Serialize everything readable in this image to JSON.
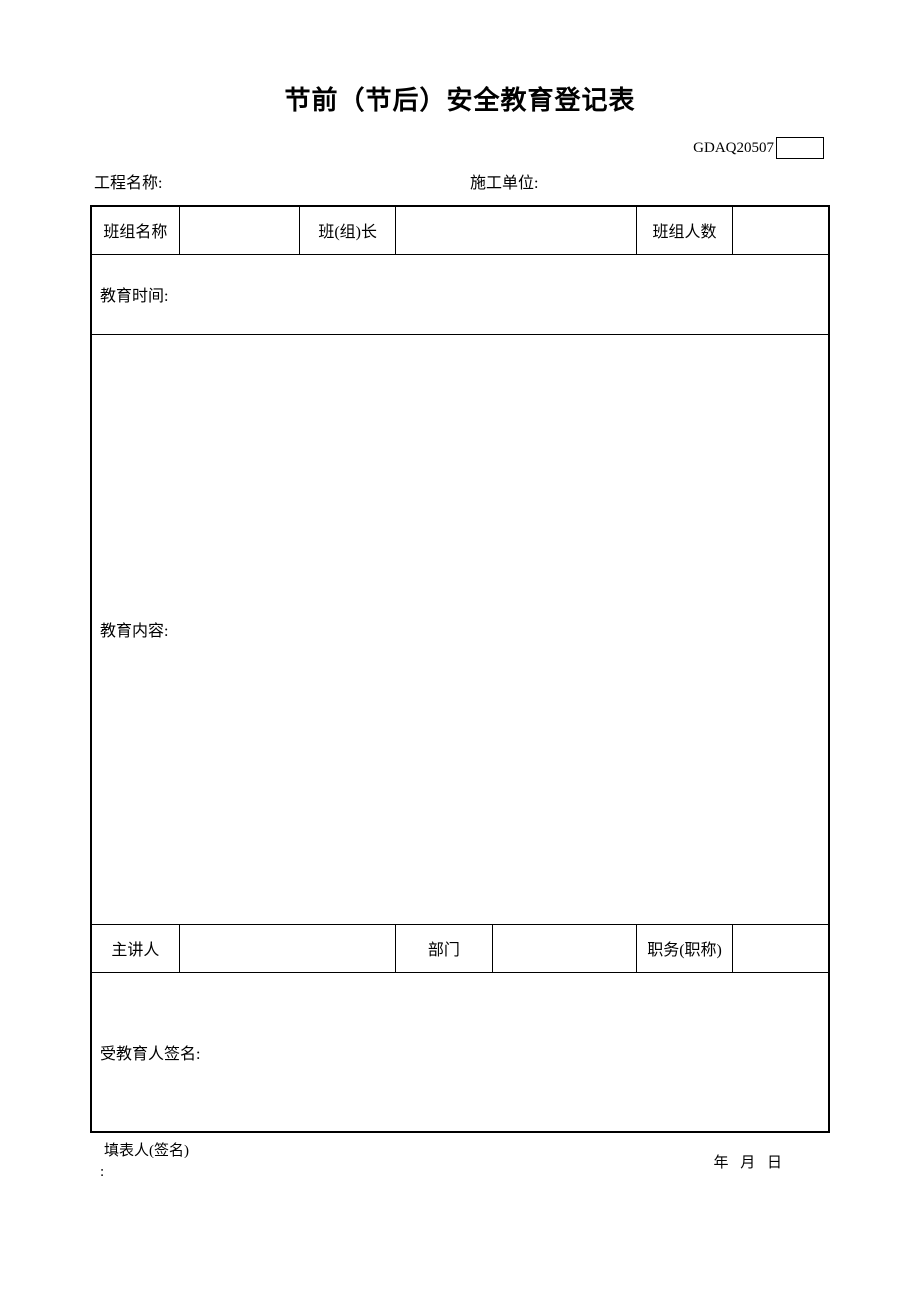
{
  "title": "节前（节后）安全教育登记表",
  "form_code": "GDAQ20507",
  "header": {
    "project_label": "工程名称:",
    "contractor_label": "施工单位:"
  },
  "row1": {
    "team_name_label": "班组名称",
    "team_leader_label": "班(组)长",
    "team_count_label": "班组人数"
  },
  "edu_time_label": "教育时间:",
  "edu_content_label": "教育内容:",
  "lecturer_row": {
    "lecturer_label": "主讲人",
    "dept_label": "部门",
    "title_label": "职务(职称)"
  },
  "signature_label": "受教育人签名:",
  "footer": {
    "filled_by_label_top": "填表人(签名)",
    "filled_by_label_bottom": ":",
    "date_label": "年  月  日"
  }
}
